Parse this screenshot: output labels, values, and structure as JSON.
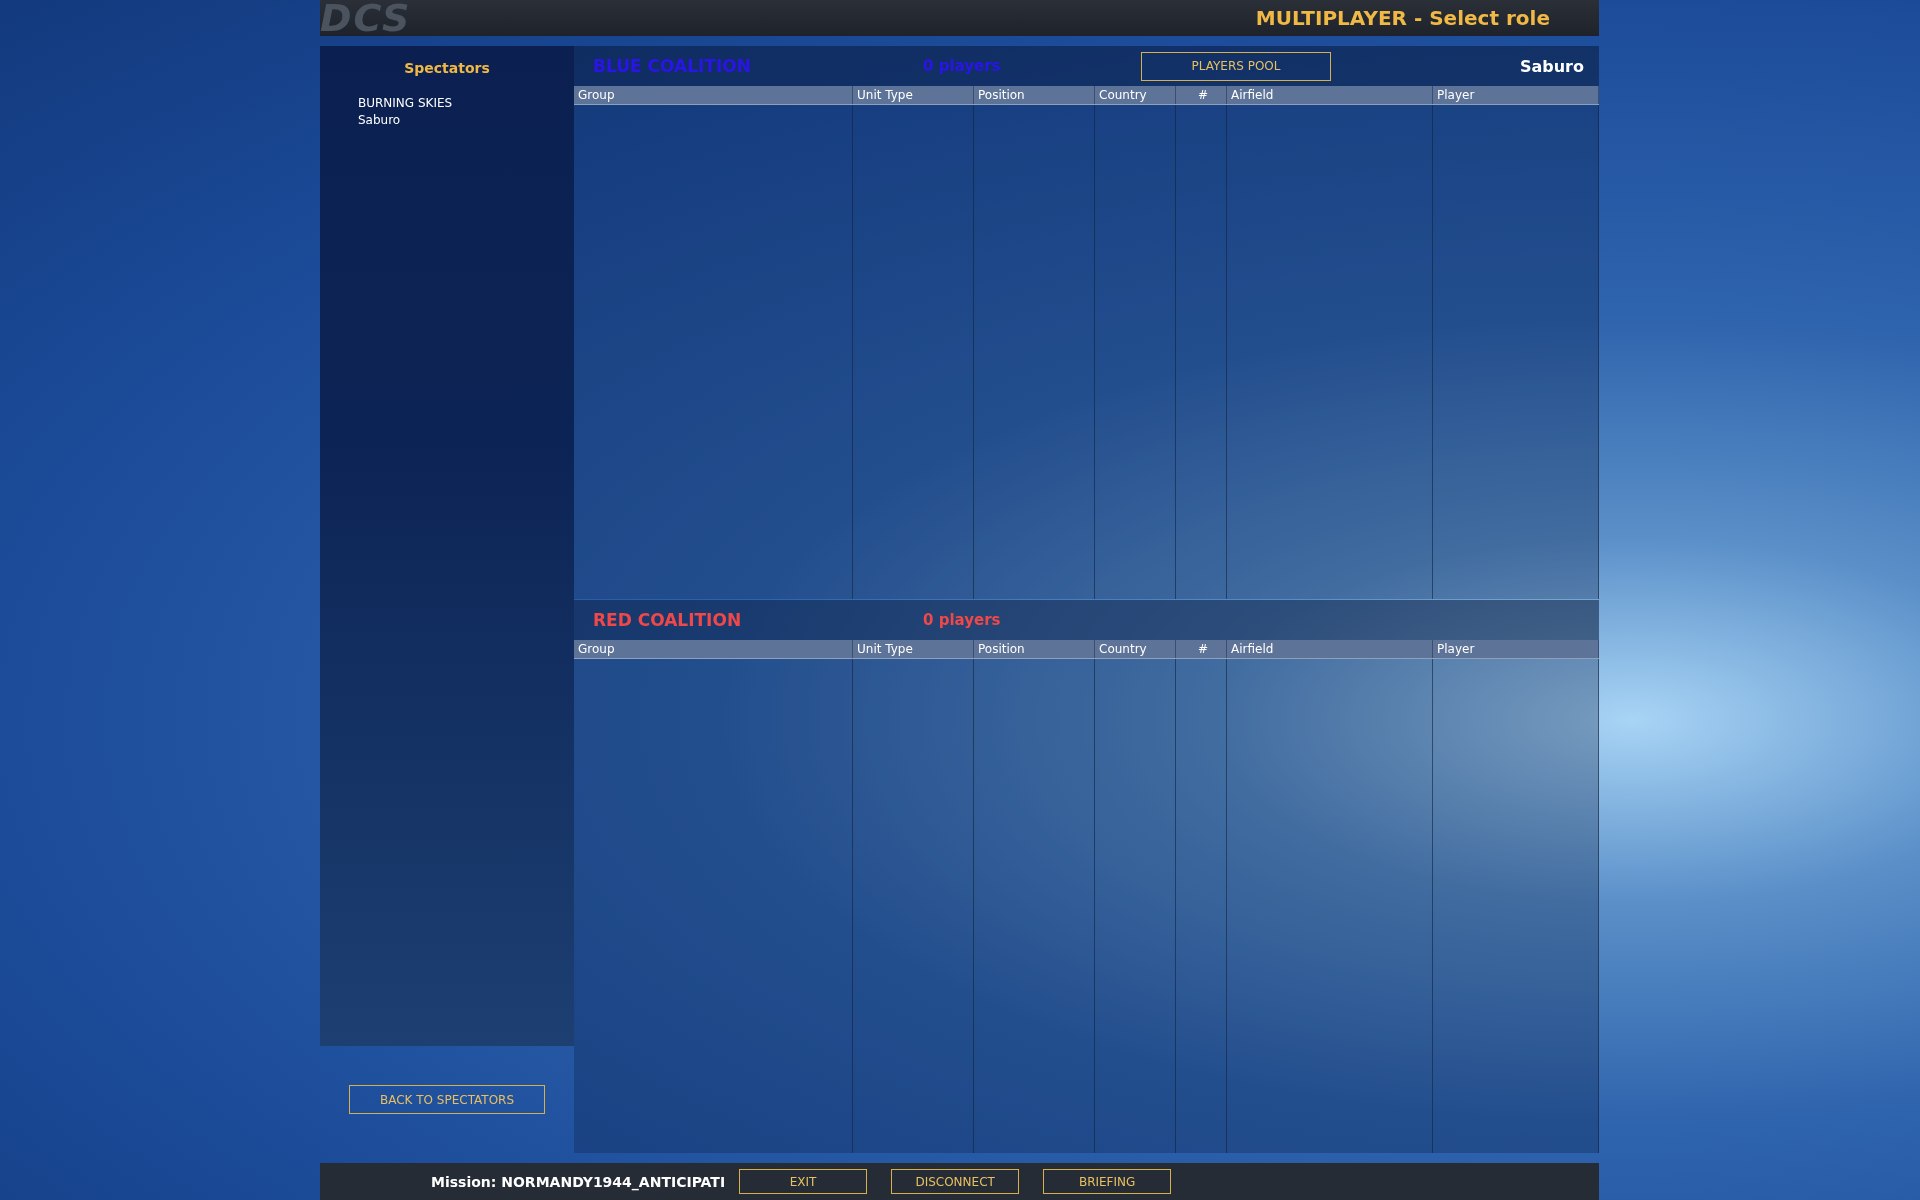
{
  "logo": "DCS",
  "window": {
    "title": "MULTIPLAYER - Select role"
  },
  "spectators": {
    "title": "Spectators",
    "players": [
      "BURNING SKIES",
      "Saburo"
    ],
    "back_button": "BACK TO SPECTATORS"
  },
  "coalitions": [
    {
      "kind": "blue",
      "name": "BLUE COALITION",
      "count": "0 players",
      "pool_button": "PLAYERS POOL",
      "current_player": "Saburo",
      "columns": [
        "Group",
        "Unit Type",
        "Position",
        "Country",
        "#",
        "Airfield",
        "Player"
      ]
    },
    {
      "kind": "red",
      "name": "RED COALITION",
      "count": "0 players",
      "columns": [
        "Group",
        "Unit Type",
        "Position",
        "Country",
        "#",
        "Airfield",
        "Player"
      ]
    }
  ],
  "bottom_bar": {
    "mission": "Mission: NORMANDY1944_ANTICIPATI",
    "buttons": [
      "EXIT",
      "DISCONNECT",
      "BRIEFING"
    ]
  }
}
